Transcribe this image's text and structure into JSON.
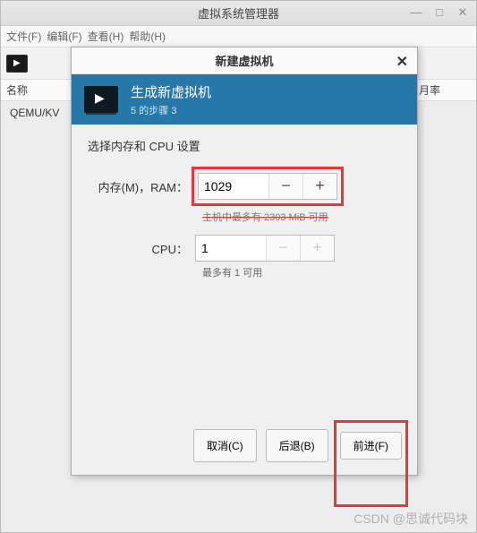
{
  "window": {
    "title": "虚拟系统管理器",
    "menu": {
      "file": "文件(F)",
      "edit": "编辑(F)",
      "view": "查看(H)",
      "help": "帮助(H)"
    },
    "columns": {
      "name": "名称",
      "rate": "月率"
    },
    "connection": "QEMU/KV"
  },
  "modal": {
    "title": "新建虚拟机",
    "header_title": "生成新虚拟机",
    "header_step": "5 的步骤 3",
    "section": "选择内存和 CPU 设置",
    "ram_label": "内存(M)，RAM：",
    "ram_value": "1029",
    "ram_hint": "主机中最多有 2303 MiB 可用",
    "cpu_label": "CPU：",
    "cpu_value": "1",
    "cpu_hint": "最多有 1 可用",
    "btn_cancel": "取消(C)",
    "btn_back": "后退(B)",
    "btn_forward": "前进(F)"
  },
  "watermark": "CSDN @思诚代码块"
}
